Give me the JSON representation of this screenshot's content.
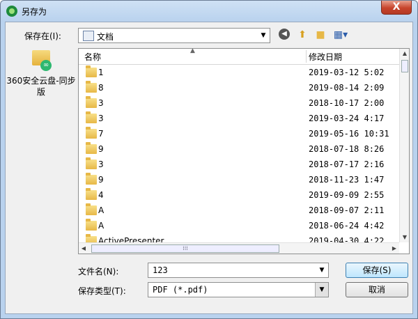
{
  "window": {
    "title": "另存为",
    "close_label": "X"
  },
  "toolbar": {
    "save_in_label": "保存在(I):",
    "location": "文档",
    "back_icon": "back-arrow-icon",
    "up_icon": "up-folder-icon",
    "new_folder_icon": "new-folder-icon",
    "view_icon": "view-menu-icon"
  },
  "places": {
    "items": [
      {
        "label": "360安全云盘-同步版",
        "icon": "cloud-folder-icon"
      }
    ]
  },
  "file_list": {
    "columns": [
      "名称",
      "修改日期"
    ],
    "rows": [
      {
        "name": "1",
        "date": "2019-03-12  5:02"
      },
      {
        "name": "8",
        "date": "2019-08-14  2:09"
      },
      {
        "name": "3",
        "date": "2018-10-17  2:00"
      },
      {
        "name": "3",
        "date": "2019-03-24  4:17"
      },
      {
        "name": "7",
        "date": "2019-05-16  10:31"
      },
      {
        "name": "9",
        "date": "2018-07-18  8:26"
      },
      {
        "name": "3",
        "date": "2018-07-17  2:16"
      },
      {
        "name": "9",
        "date": "2018-11-23  1:47"
      },
      {
        "name": "4",
        "date": "2019-09-09  2:55"
      },
      {
        "name": "A",
        "date": "2018-09-07  2:11"
      },
      {
        "name": "A",
        "date": "2018-06-24  4:42"
      },
      {
        "name": "ActivePresenter",
        "date": "2019-04-30  4:22"
      }
    ]
  },
  "form": {
    "filename_label": "文件名(N):",
    "filename_value": "123",
    "filetype_label": "保存类型(T):",
    "filetype_value": "PDF (*.pdf)",
    "save_button": "保存(S)",
    "cancel_button": "取消"
  }
}
